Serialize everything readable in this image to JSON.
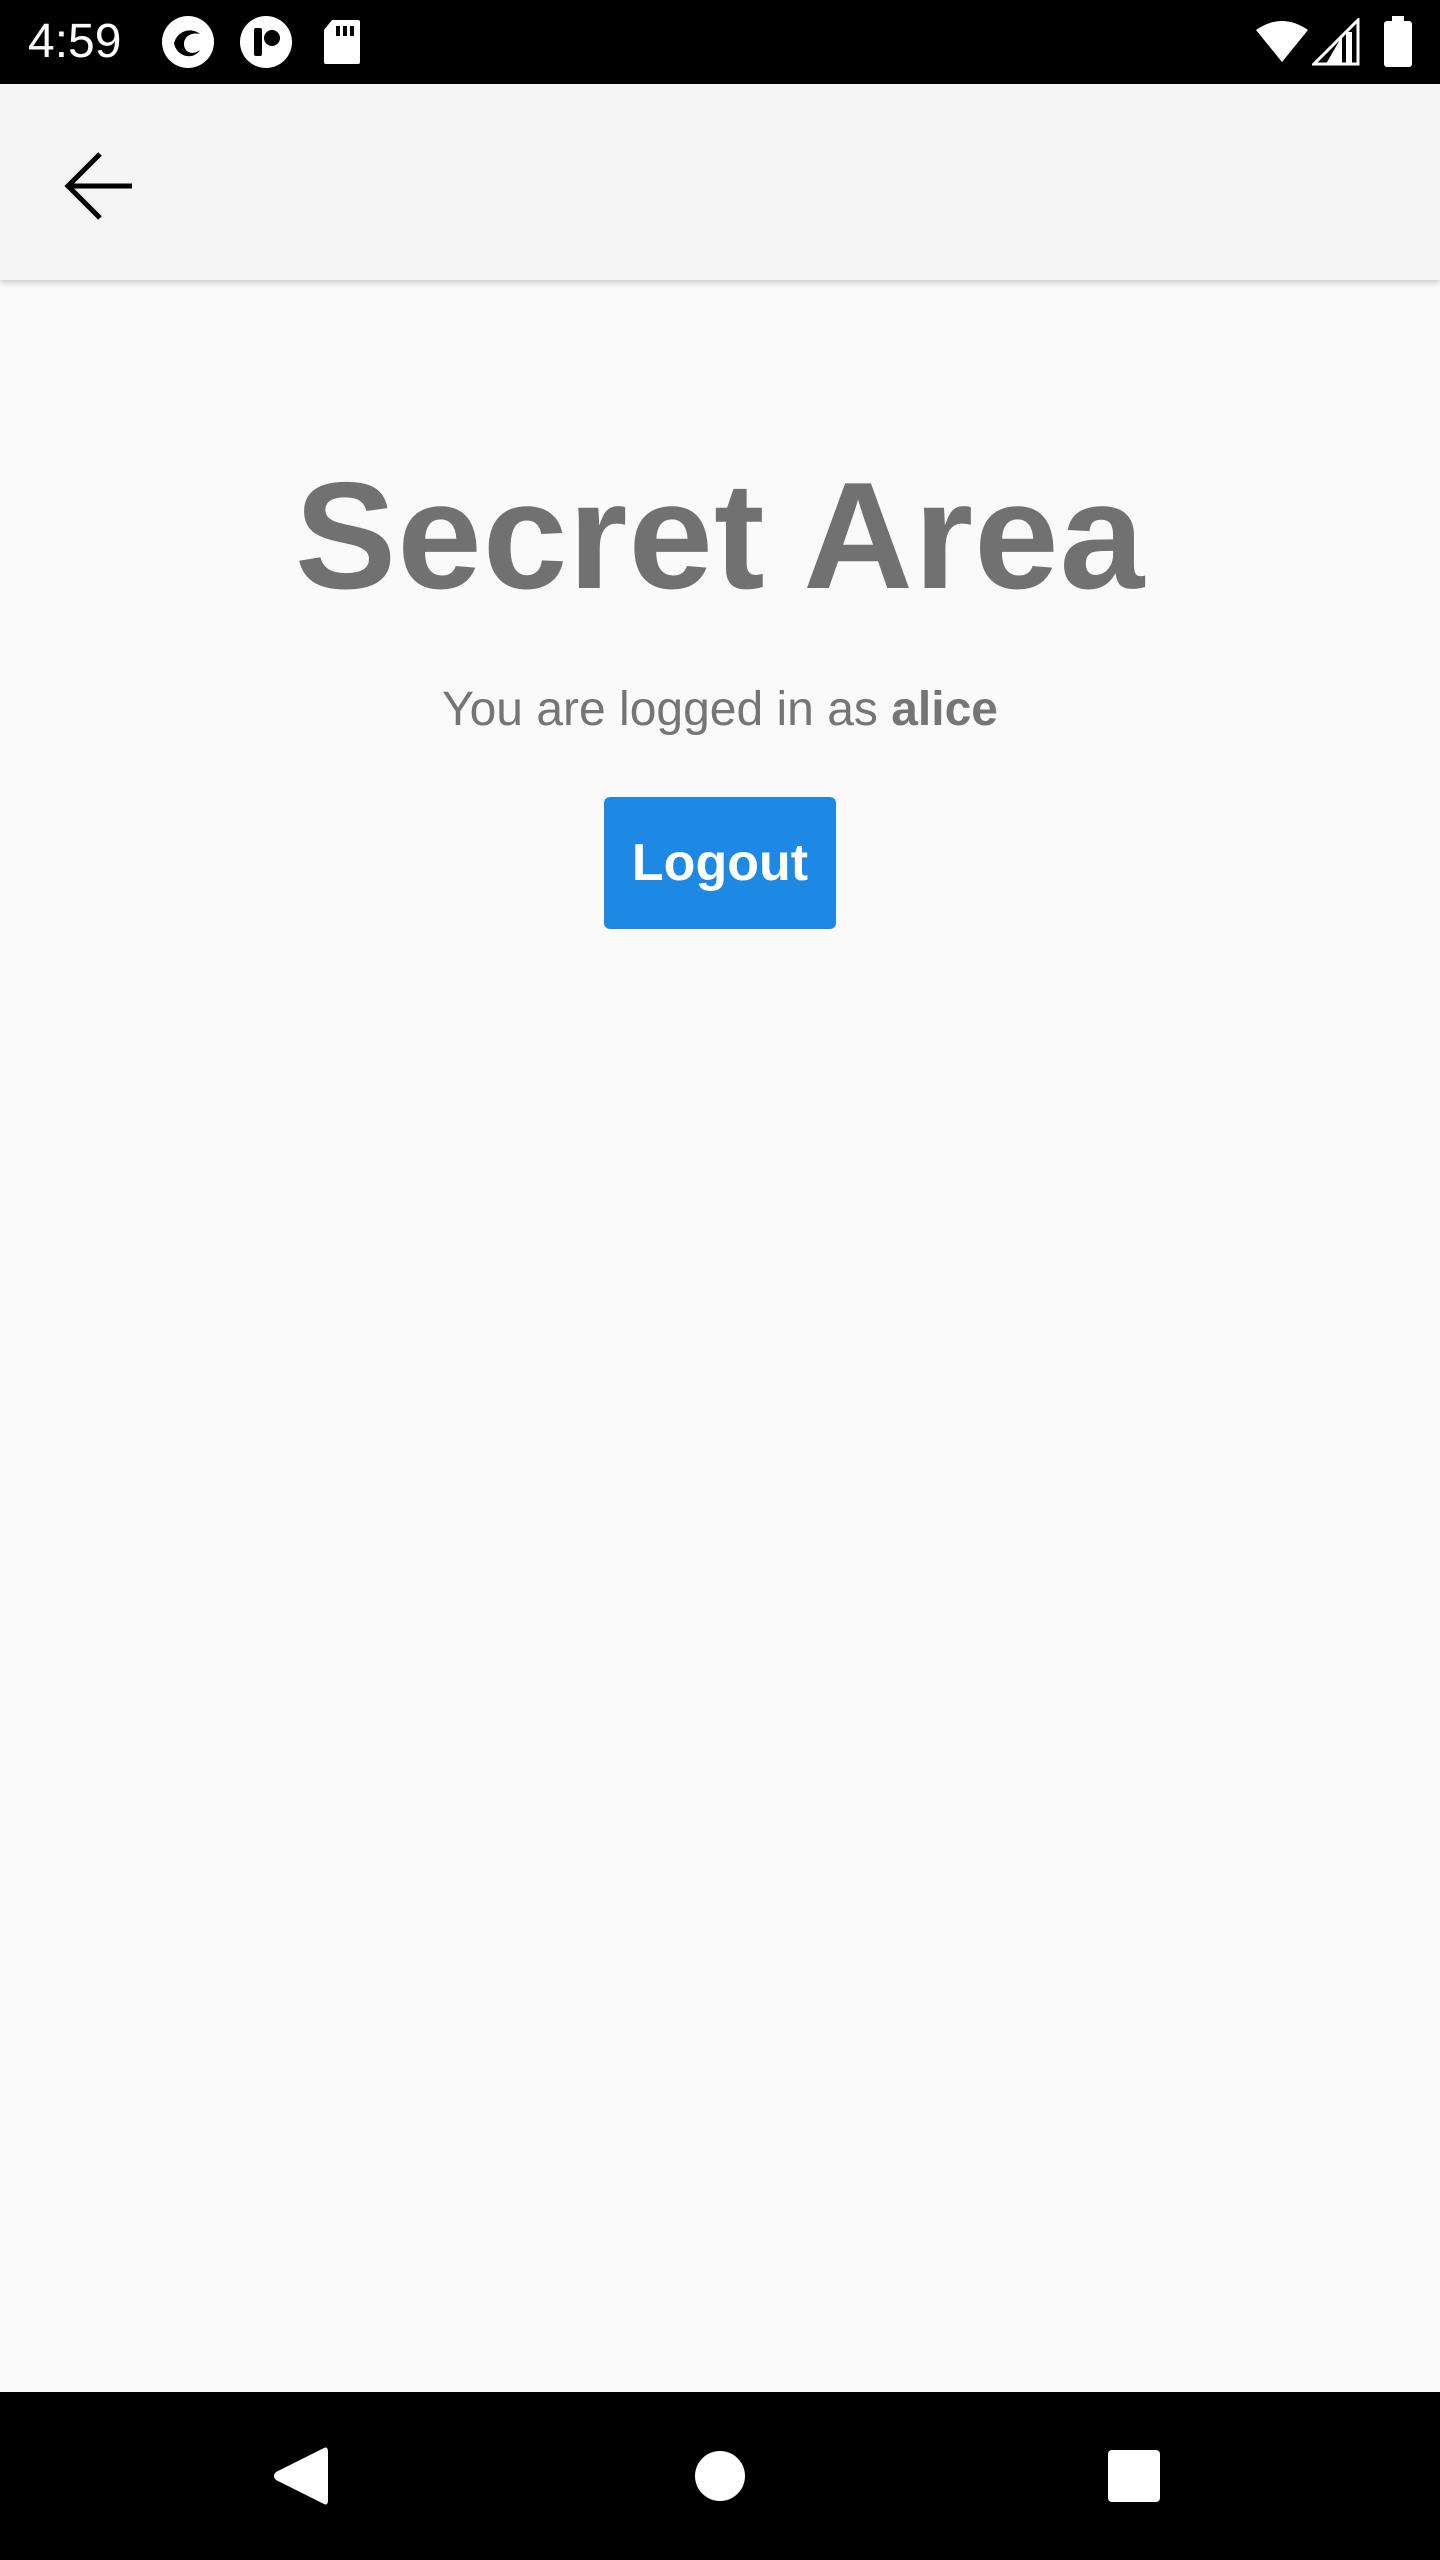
{
  "status_bar": {
    "time": "4:59",
    "icons": [
      "app-notification-icon-1",
      "app-notification-icon-2",
      "sd-card-icon",
      "wifi-icon",
      "cell-signal-icon",
      "battery-icon"
    ]
  },
  "app_bar": {
    "back_icon": "arrow-left-icon"
  },
  "main": {
    "title": "Secret Area",
    "login_prefix": "You are logged in as ",
    "username": "alice",
    "logout_label": "Logout"
  },
  "nav_bar": {
    "icons": [
      "back-triangle-icon",
      "home-circle-icon",
      "recents-square-icon"
    ]
  },
  "colors": {
    "accent": "#1e88e5",
    "title_text": "#717171",
    "body_text": "#757575",
    "background": "#fafafa",
    "app_bar": "#f5f5f5"
  }
}
